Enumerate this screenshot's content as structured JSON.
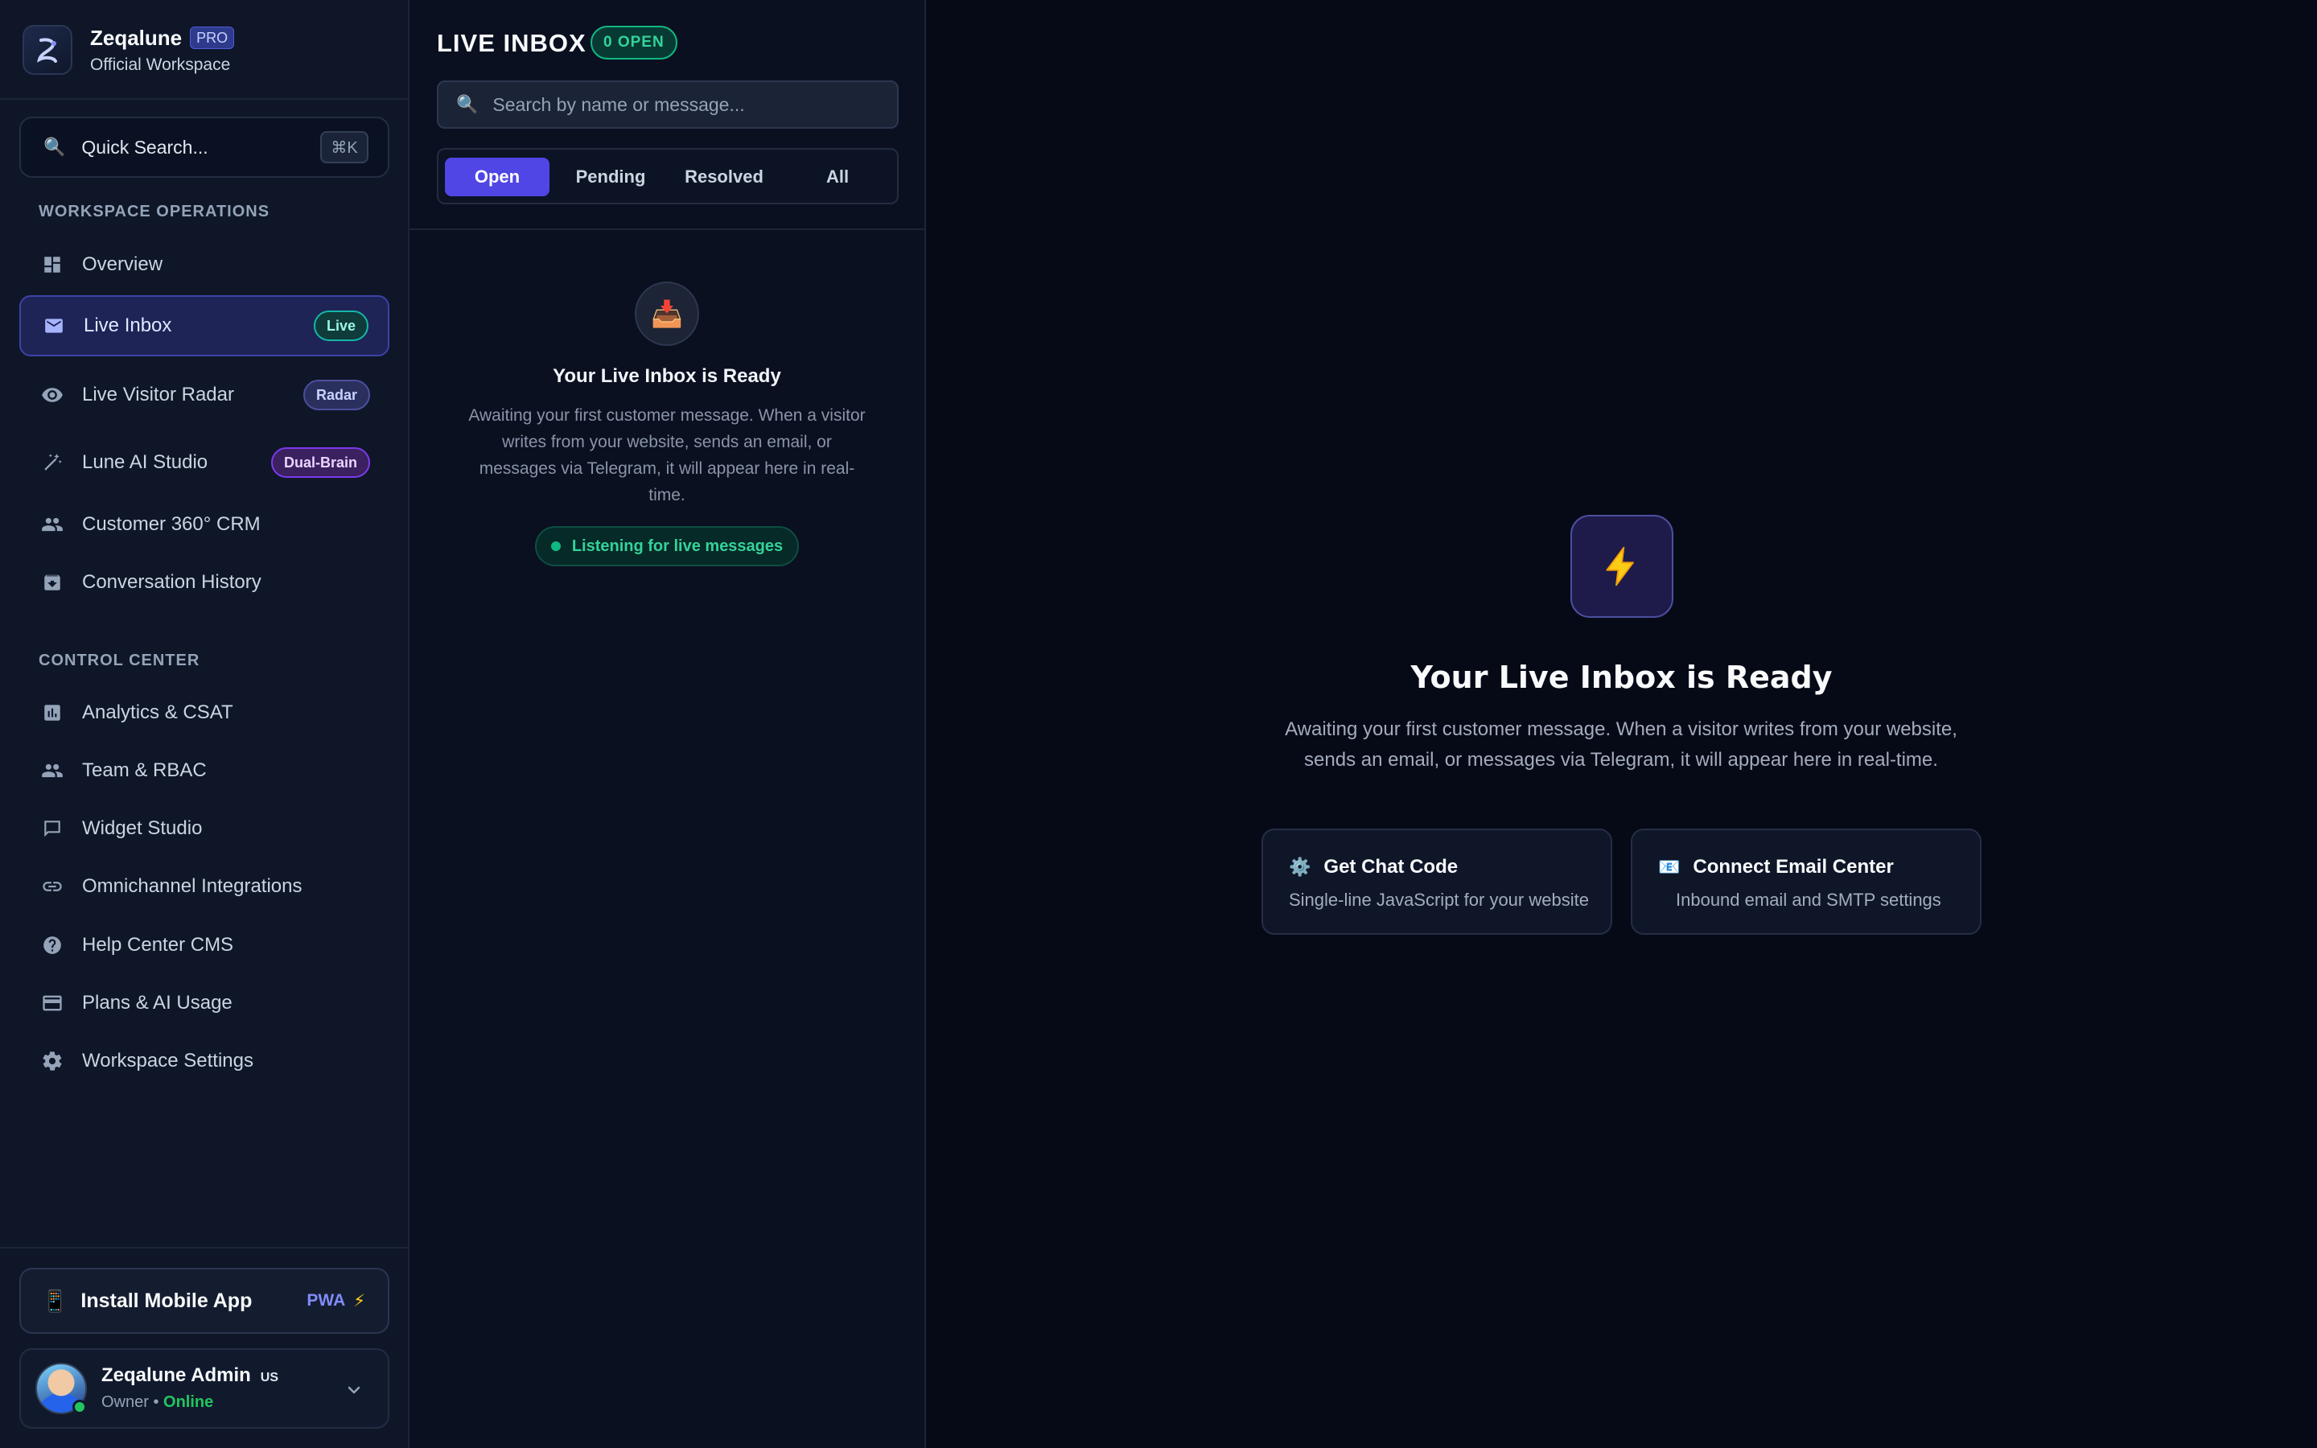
{
  "brand": {
    "name": "Zeqalune",
    "tier": "PRO",
    "workspace": "Official Workspace"
  },
  "quick_search": {
    "label": "Quick Search...",
    "shortcut": "⌘K"
  },
  "sections": {
    "workspace": "WORKSPACE OPERATIONS",
    "control": "CONTROL CENTER"
  },
  "nav": {
    "overview": "Overview",
    "live_inbox": {
      "label": "Live Inbox",
      "badge": "Live"
    },
    "visitor_radar": {
      "label": "Live Visitor Radar",
      "badge": "Radar"
    },
    "ai_studio": {
      "label": "Lune AI Studio",
      "badge": "Dual-Brain"
    },
    "crm": "Customer 360° CRM",
    "history": "Conversation History",
    "analytics": "Analytics & CSAT",
    "team": "Team & RBAC",
    "widget": "Widget Studio",
    "integrations": "Omnichannel Integrations",
    "help": "Help Center CMS",
    "plans": "Plans & AI Usage",
    "settings": "Workspace Settings"
  },
  "install": {
    "label": "Install Mobile App",
    "badge": "PWA"
  },
  "user": {
    "name": "Zeqalune Admin",
    "country": "US",
    "role": "Owner •",
    "status": "Online"
  },
  "inbox": {
    "title": "LIVE INBOX",
    "open_badge": "0 OPEN",
    "search_placeholder": "Search by name or message...",
    "tabs": [
      "Open",
      "Pending",
      "Resolved",
      "All"
    ],
    "active_tab": "Open",
    "empty_title": "Your Live Inbox is Ready",
    "empty_desc": "Awaiting your first customer message. When a visitor writes from your website, sends an email, or messages via Telegram, it will appear here in real-time.",
    "listening": "Listening for live messages"
  },
  "main": {
    "title": "Your Live Inbox is Ready",
    "desc": "Awaiting your first customer message. When a visitor writes from your website, sends an email, or messages via Telegram, it will appear here in real-time.",
    "cards": [
      {
        "title": "Get Chat Code",
        "sub": "Single-line JavaScript for your website"
      },
      {
        "title": "Connect Email Center",
        "sub": "Inbound email and SMTP settings"
      }
    ]
  },
  "colors": {
    "accent": "#4f46e5",
    "success": "#10b981",
    "bolt": "#facc15",
    "bg": "#070b19"
  }
}
